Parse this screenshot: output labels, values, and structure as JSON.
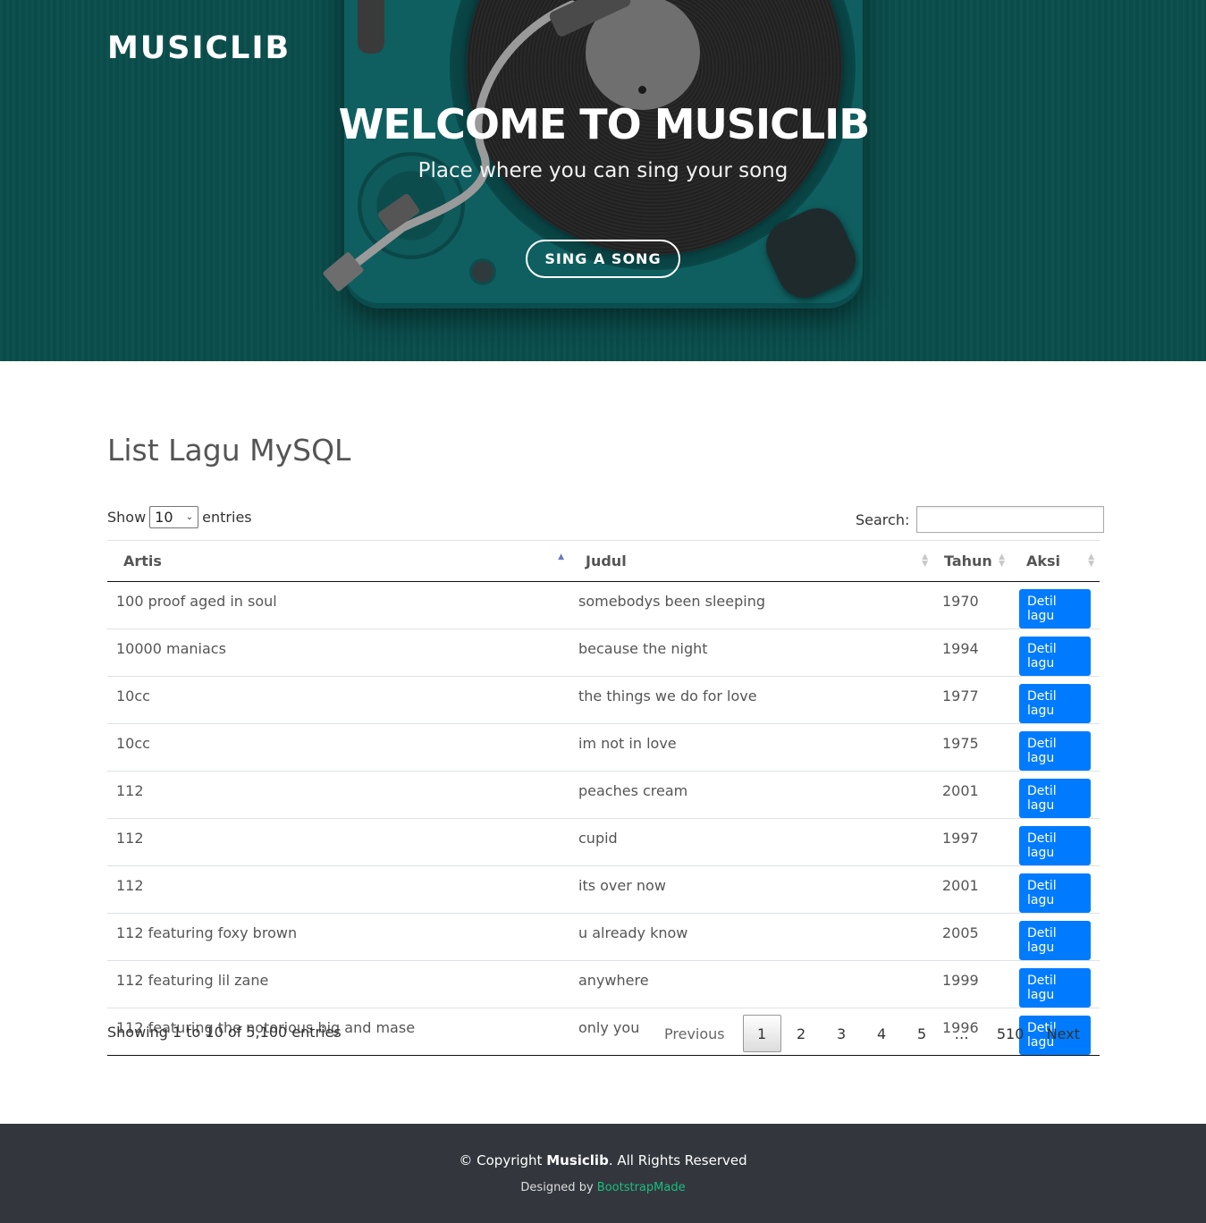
{
  "header": {
    "brand": "MUSICLIB",
    "title": "WELCOME TO MUSICLIB",
    "subtitle": "Place where you can sing your song",
    "cta_label": "SING A SONG"
  },
  "section": {
    "title": "List Lagu MySQL"
  },
  "controls": {
    "show_label": "Show",
    "length_value": "10",
    "entries_label": "entries",
    "search_label": "Search:",
    "search_value": ""
  },
  "table": {
    "columns": [
      "Artis",
      "Judul",
      "Tahun",
      "Aksi"
    ],
    "action_label": "Detil lagu",
    "rows": [
      {
        "artis": "100 proof aged in soul",
        "judul": "somebodys been sleeping",
        "tahun": "1970"
      },
      {
        "artis": "10000 maniacs",
        "judul": "because the night",
        "tahun": "1994"
      },
      {
        "artis": "10cc",
        "judul": "the things we do for love",
        "tahun": "1977"
      },
      {
        "artis": "10cc",
        "judul": "im not in love",
        "tahun": "1975"
      },
      {
        "artis": "112",
        "judul": "peaches cream",
        "tahun": "2001"
      },
      {
        "artis": "112",
        "judul": "cupid",
        "tahun": "1997"
      },
      {
        "artis": "112",
        "judul": "its over now",
        "tahun": "2001"
      },
      {
        "artis": "112 featuring foxy brown",
        "judul": "u already know",
        "tahun": "2005"
      },
      {
        "artis": "112 featuring lil zane",
        "judul": "anywhere",
        "tahun": "1999"
      },
      {
        "artis": "112 featuring the notorious big and mase",
        "judul": "only you",
        "tahun": "1996"
      }
    ]
  },
  "pagination": {
    "info": "Showing 1 to 10 of 5,100 entries",
    "previous": "Previous",
    "pages": [
      "1",
      "2",
      "3",
      "4",
      "5"
    ],
    "current": "1",
    "ellipsis": "…",
    "last": "510",
    "next": "Next"
  },
  "footer": {
    "copyright_prefix": "© Copyright",
    "brand": "Musiclib",
    "copyright_suffix": ". All Rights Reserved",
    "designed_by": "Designed by",
    "designer": "BootstrapMade"
  },
  "colors": {
    "hero_bg": "#0a4e4c",
    "primary_button": "#007bff",
    "footer_bg": "#33373d",
    "footer_link": "#1bbd7e"
  }
}
